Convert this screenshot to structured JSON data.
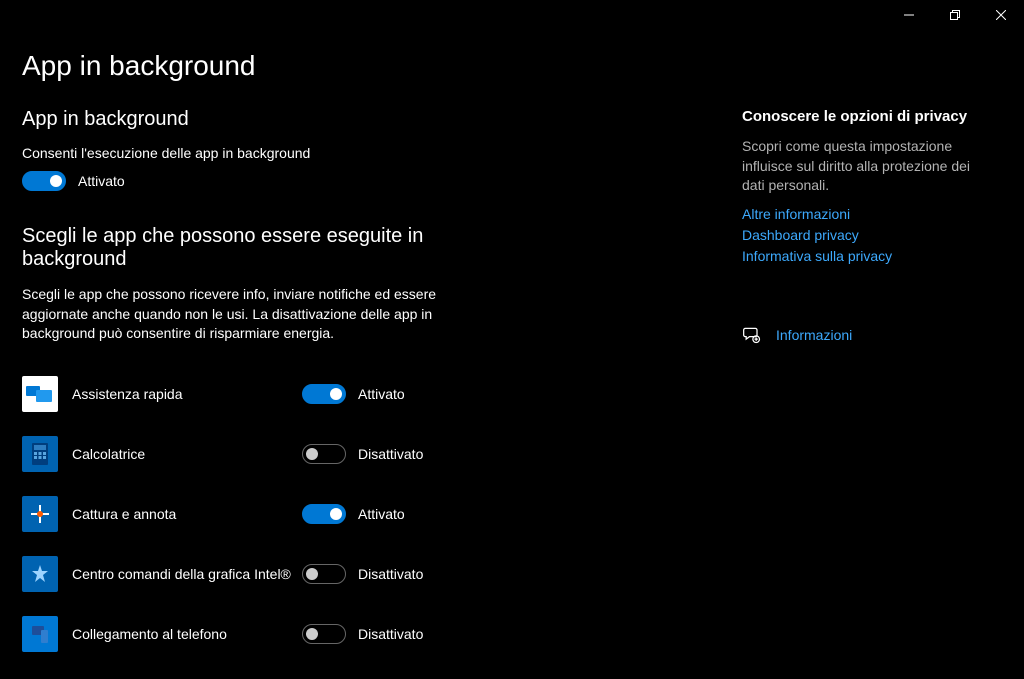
{
  "window": {
    "minimize": "Minimize",
    "restore": "Restore",
    "close": "Close"
  },
  "page": {
    "title": "App in background"
  },
  "master_toggle": {
    "heading": "App in background",
    "caption": "Consenti l'esecuzione delle app in background",
    "state_label": "Attivato",
    "on": true
  },
  "choose": {
    "heading": "Scegli le app che possono essere eseguite in background",
    "description": "Scegli le app che possono ricevere info, inviare notifiche ed essere aggiornate anche quando non le usi. La disattivazione delle app in background può consentire di risparmiare energia."
  },
  "labels": {
    "on": "Attivato",
    "off": "Disattivato"
  },
  "apps": [
    {
      "name": "Assistenza rapida",
      "on": true,
      "icon": "quick"
    },
    {
      "name": "Calcolatrice",
      "on": false,
      "icon": "calc"
    },
    {
      "name": "Cattura e annota",
      "on": true,
      "icon": "snip"
    },
    {
      "name": "Centro comandi della grafica Intel®",
      "on": false,
      "icon": "intel"
    },
    {
      "name": "Collegamento al telefono",
      "on": false,
      "icon": "phone"
    }
  ],
  "sidebar": {
    "title": "Conoscere le opzioni di privacy",
    "description": "Scopri come questa impostazione influisce sul diritto alla protezione dei dati personali.",
    "links": [
      "Altre informazioni",
      "Dashboard privacy",
      "Informativa sulla privacy"
    ],
    "feedback": "Informazioni"
  }
}
